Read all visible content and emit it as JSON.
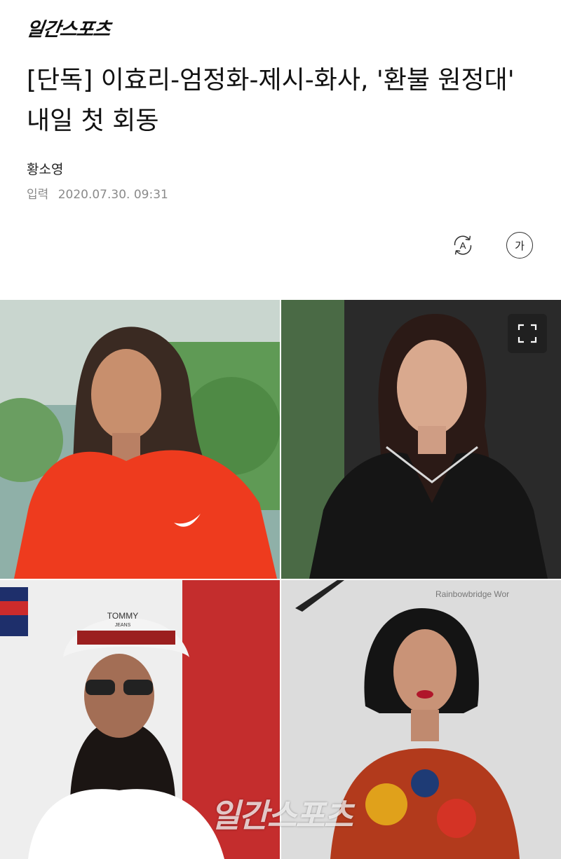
{
  "header": {
    "logo_text": "일간스포츠"
  },
  "article": {
    "headline": "[단독] 이효리-엄정화-제시-화사, '환불 원정대' 내일 첫 회동",
    "author": "황소영",
    "date_label": "입력",
    "date_value": "2020.07.30. 09:31"
  },
  "tools": {
    "auto_label": "A",
    "font_label": "가"
  },
  "photo": {
    "watermark": "일간스포츠",
    "cap_text": "TOMMY",
    "cap_sub": "JEANS",
    "background_text": "Rainbowbridge Wor"
  }
}
